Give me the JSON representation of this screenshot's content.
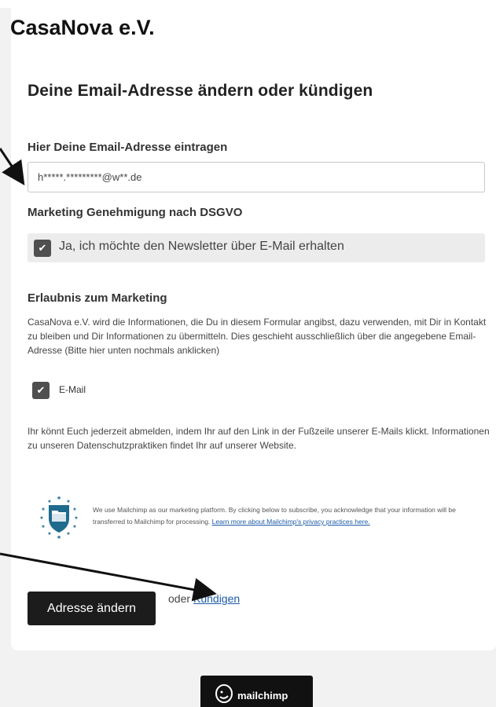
{
  "header": {
    "org_name": "CasaNova e.V."
  },
  "form": {
    "heading": "Deine Email-Adresse ändern oder kündigen",
    "email_label": "Hier Deine Email-Adresse eintragen",
    "email_value": "h*****.*********@w**.de",
    "marketing_label": "Marketing Genehmigung nach DSGVO",
    "newsletter_option": {
      "label": "Ja, ich möchte den Newsletter über E-Mail erhalten",
      "checked": true
    },
    "permission_heading": "Erlaubnis zum Marketing",
    "permission_text": "CasaNova e.V. wird die Informationen, die Du in diesem Formular angibst, dazu verwenden, mit Dir in Kontakt zu bleiben und Dir Informationen zu übermitteln. Dies geschieht ausschließlich über die angegebene Email-Adresse (Bitte hier unten nochmals anklicken)",
    "email_option": {
      "label": "E-Mail",
      "checked": true
    },
    "unsubscribe_text": "Ihr könnt Euch jederzeit abmelden, indem Ihr auf den Link in der Fußzeile unserer E-Mails klickt. Informationen zu unseren Datenschutzpraktiken findet Ihr auf unserer Website.",
    "mailchimp_notice": "We use Mailchimp as our marketing platform. By clicking below to subscribe, you acknowledge that your information will be transferred to Mailchimp for processing.",
    "mailchimp_link": "Learn more about Mailchimp's privacy practices here.",
    "submit_label": "Adresse ändern",
    "or_text": "oder",
    "cancel_link": "Kündigen"
  },
  "footer": {
    "badge_text": "mailchimp"
  },
  "colors": {
    "button_bg": "#1c1c1c",
    "link": "#1c5aa8",
    "checkbox": "#4f4f4f",
    "option_bg": "#ececec"
  },
  "icons": [
    "checkmark-icon",
    "shield-folder-icon",
    "mailchimp-logo-icon"
  ]
}
